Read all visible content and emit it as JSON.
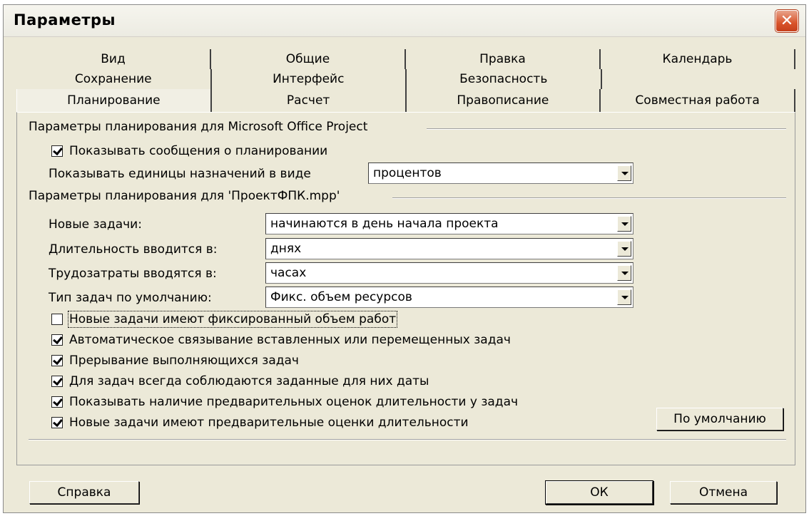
{
  "window": {
    "title": "Параметры"
  },
  "tabs": {
    "row1": [
      "Вид",
      "Общие",
      "Правка",
      "Календарь"
    ],
    "row2": [
      "Сохранение",
      "Интерфейс",
      "Безопасность",
      ""
    ],
    "row3": [
      "Планирование",
      "Расчет",
      "Правописание",
      "Совместная работа"
    ]
  },
  "project_group": {
    "label": "Параметры планирования для Microsoft Office Project",
    "show_messages": {
      "label": "Показывать сообщения о планировании",
      "checked": true
    },
    "units_label": "Показывать единицы назначений в виде",
    "units_value": "процентов"
  },
  "file_group": {
    "label": "Параметры планирования для 'ПроектФПК.mpp'",
    "new_tasks_label": "Новые задачи:",
    "new_tasks_value": "начинаются в день начала проекта",
    "duration_label": "Длительность вводится в:",
    "duration_value": "днях",
    "work_label": "Трудозатраты вводятся в:",
    "work_value": "часах",
    "task_type_label": "Тип задач по умолчанию:",
    "task_type_value": "Фикс. объем ресурсов"
  },
  "options": [
    {
      "label": "Новые задачи имеют фиксированный объем работ",
      "checked": false
    },
    {
      "label": "Автоматическое связывание вставленных или перемещенных задач",
      "checked": true
    },
    {
      "label": "Прерывание выполняющихся задач",
      "checked": true
    },
    {
      "label": "Для задач всегда соблюдаются заданные для них даты",
      "checked": true
    },
    {
      "label": "Показывать наличие предварительных оценок длительности у задач",
      "checked": true
    },
    {
      "label": "Новые задачи имеют предварительные оценки длительности",
      "checked": true
    }
  ],
  "buttons": {
    "default": "По умолчанию",
    "help": "Справка",
    "ok": "ОК",
    "cancel": "Отмена"
  }
}
